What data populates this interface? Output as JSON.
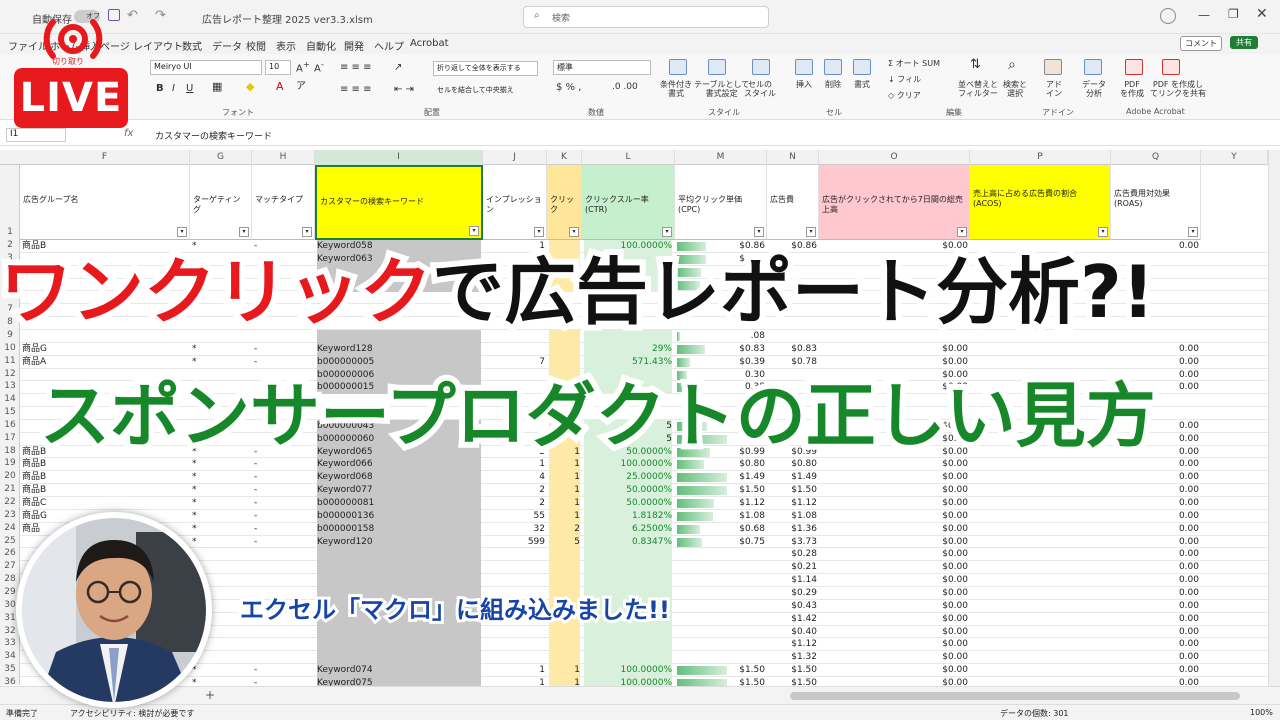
{
  "window": {
    "autosave_label": "自動保存",
    "autosave_state": "オフ",
    "file_title": "広告レポート整理 2025 ver3.3.xlsm",
    "search_placeholder": "検索"
  },
  "menu": {
    "items": [
      "ファイル",
      "ホーム",
      "挿入",
      "ページ レイアウト",
      "数式",
      "データ",
      "校閲",
      "表示",
      "自動化",
      "開発",
      "ヘルプ",
      "Acrobat"
    ],
    "comment_button": "コメント",
    "share_button": "共有"
  },
  "ribbon": {
    "font_name": "Meiryo UI",
    "font_size": "10",
    "wrap_text": "折り返して全体を表示する",
    "merge_center": "セルを結合して中央揃え",
    "number_format": "標準",
    "groups": {
      "font": "フォント",
      "alignment": "配置",
      "number": "数値",
      "styles": "スタイル",
      "cells": "セル",
      "editing": "編集",
      "addins": "アドイン",
      "acrobat": "Adobe Acrobat"
    },
    "buttons": {
      "conditional_format": "条件付き\n書式",
      "format_as_table": "テーブルとして\n書式設定",
      "cell_styles": "セルの\nスタイル",
      "insert": "挿入",
      "delete": "削除",
      "format": "書式",
      "autosum": "オート SUM",
      "fill": "フィル",
      "clear": "クリア",
      "sort_filter": "並べ替えと\nフィルター",
      "find_select": "検索と\n選択",
      "addins": "アド\nイン",
      "data_analysis": "データ\n分析",
      "create_pdf": "PDF\nを作成",
      "create_pdf_share": "PDF を作成し\nてリンクを共有"
    }
  },
  "formula_bar": {
    "name_box": "I1",
    "content": "カスタマーの検索キーワード"
  },
  "columns": [
    "F",
    "G",
    "H",
    "I",
    "J",
    "K",
    "L",
    "M",
    "N",
    "O",
    "P",
    "Q",
    "Y"
  ],
  "headers": [
    "広告グループ名",
    "ターゲティング",
    "マッチタイプ",
    "カスタマーの検索キーワード",
    "インプレッション",
    "クリック",
    "クリックスルー率 (CTR)",
    "平均クリック単価 (CPC)",
    "広告費",
    "広告がクリックされてから7日間の総売上高",
    "売上高に占める広告費の割合 (ACOS)",
    "広告費用対効果 (ROAS)"
  ],
  "rows": [
    {
      "n": "2",
      "F": "商品B",
      "G": "*",
      "H": "-",
      "I": "Keyword058",
      "J": "1",
      "K": "",
      "L": "100.0000%",
      "M": "$0.86",
      "N": "$0.86",
      "O": "$0.00",
      "Q": "0.00"
    },
    {
      "n": "3",
      "F": "",
      "G": "",
      "H": "",
      "I": "Keyword063",
      "J": "",
      "K": "",
      "L": "",
      "M": "$0.86",
      "N": "",
      "O": "",
      "Q": ""
    },
    {
      "n": "4",
      "F": "",
      "G": "",
      "H": "",
      "I": "",
      "J": "",
      "K": "",
      "L": "",
      "M": "$0.72",
      "N": "",
      "O": "",
      "Q": ""
    },
    {
      "n": "5",
      "F": "",
      "G": "",
      "H": "",
      "I": "",
      "J": "",
      "K": "",
      "L": "",
      "M": "$0.7",
      "N": "",
      "O": "",
      "Q": ""
    },
    {
      "n": "9",
      "F": "",
      "G": "",
      "H": "",
      "I": "",
      "J": "",
      "K": "",
      "L": "",
      "M": ".08",
      "N": "",
      "O": "",
      "Q": ""
    },
    {
      "n": "10",
      "F": "商品G",
      "G": "*",
      "H": "-",
      "I": "Keyword128",
      "J": "",
      "K": "",
      "L": "29%",
      "M": "$0.83",
      "N": "$0.83",
      "O": "$0.00",
      "Q": "0.00"
    },
    {
      "n": "11",
      "F": "商品A",
      "G": "*",
      "H": "-",
      "I": "b000000005",
      "J": "7",
      "K": "",
      "L": "571.43%",
      "M": "$0.39",
      "N": "$0.78",
      "O": "$0.00",
      "Q": "0.00"
    },
    {
      "n": "12",
      "F": "",
      "G": "",
      "H": "",
      "I": "b000000006",
      "J": "",
      "K": "",
      "L": "",
      "M": "0.30",
      "N": "",
      "O": "$0.00",
      "Q": "0.00"
    },
    {
      "n": "13",
      "F": "",
      "G": "",
      "H": "",
      "I": "b000000015",
      "J": "",
      "K": "",
      "L": "",
      "M": "0.38",
      "N": "",
      "O": "$0.00",
      "Q": "0.00"
    },
    {
      "n": "16",
      "F": "",
      "G": "",
      "H": "",
      "I": "b000000043",
      "J": "",
      "K": "",
      "L": "5",
      "M": "0.9",
      "N": "",
      "O": "$0.00",
      "Q": "0.00"
    },
    {
      "n": "17",
      "F": "",
      "G": "",
      "H": "",
      "I": "b000000060",
      "J": "",
      "K": "",
      "L": "5",
      "M": "1.50",
      "N": "",
      "O": "$0.00",
      "Q": "0.00"
    },
    {
      "n": "18",
      "F": "商品B",
      "G": "*",
      "H": "-",
      "I": "Keyword065",
      "J": "2",
      "K": "1",
      "L": "50.0000%",
      "M": "$0.99",
      "N": "$0.99",
      "O": "$0.00",
      "Q": "0.00"
    },
    {
      "n": "19",
      "F": "商品B",
      "G": "*",
      "H": "-",
      "I": "Keyword066",
      "J": "1",
      "K": "1",
      "L": "100.0000%",
      "M": "$0.80",
      "N": "$0.80",
      "O": "$0.00",
      "Q": "0.00"
    },
    {
      "n": "20",
      "F": "商品B",
      "G": "*",
      "H": "-",
      "I": "Keyword068",
      "J": "4",
      "K": "1",
      "L": "25.0000%",
      "M": "$1.49",
      "N": "$1.49",
      "O": "$0.00",
      "Q": "0.00"
    },
    {
      "n": "21",
      "F": "商品B",
      "G": "*",
      "H": "-",
      "I": "Keyword077",
      "J": "2",
      "K": "1",
      "L": "50.0000%",
      "M": "$1.50",
      "N": "$1.50",
      "O": "$0.00",
      "Q": "0.00"
    },
    {
      "n": "22",
      "F": "商品C",
      "G": "*",
      "H": "-",
      "I": "b000000081",
      "J": "2",
      "K": "1",
      "L": "50.0000%",
      "M": "$1.12",
      "N": "$1.12",
      "O": "$0.00",
      "Q": "0.00"
    },
    {
      "n": "23",
      "F": "商品G",
      "G": "*",
      "H": "-",
      "I": "b000000136",
      "J": "55",
      "K": "1",
      "L": "1.8182%",
      "M": "$1.08",
      "N": "$1.08",
      "O": "$0.00",
      "Q": "0.00"
    },
    {
      "n": "24",
      "F": "商品",
      "G": "*",
      "H": "-",
      "I": "b000000158",
      "J": "32",
      "K": "2",
      "L": "6.2500%",
      "M": "$0.68",
      "N": "$1.36",
      "O": "$0.00",
      "Q": "0.00"
    },
    {
      "n": "25",
      "F": "",
      "G": "*",
      "H": "-",
      "I": "Keyword120",
      "J": "599",
      "K": "5",
      "L": "0.8347%",
      "M": "$0.75",
      "N": "$3.73",
      "O": "$0.00",
      "Q": "0.00"
    },
    {
      "n": "26",
      "F": "",
      "G": "",
      "H": "",
      "I": "",
      "J": "",
      "K": "",
      "L": "",
      "M": "",
      "N": "$0.28",
      "O": "$0.00",
      "Q": "0.00"
    },
    {
      "n": "27",
      "F": "",
      "G": "",
      "H": "",
      "I": "",
      "J": "",
      "K": "",
      "L": "",
      "M": "",
      "N": "$0.21",
      "O": "$0.00",
      "Q": "0.00"
    },
    {
      "n": "28",
      "F": "",
      "G": "",
      "H": "",
      "I": "",
      "J": "",
      "K": "",
      "L": "",
      "M": "",
      "N": "$1.14",
      "O": "$0.00",
      "Q": "0.00"
    },
    {
      "n": "29",
      "F": "",
      "G": "",
      "H": "",
      "I": "",
      "J": "",
      "K": "",
      "L": "",
      "M": "",
      "N": "$0.29",
      "O": "$0.00",
      "Q": "0.00"
    },
    {
      "n": "30",
      "F": "",
      "G": "",
      "H": "",
      "I": "",
      "J": "",
      "K": "",
      "L": "",
      "M": "",
      "N": "$0.43",
      "O": "$0.00",
      "Q": "0.00"
    },
    {
      "n": "31",
      "F": "",
      "G": "",
      "H": "",
      "I": "",
      "J": "",
      "K": "",
      "L": "",
      "M": "",
      "N": "$1.42",
      "O": "$0.00",
      "Q": "0.00"
    },
    {
      "n": "32",
      "F": "",
      "G": "",
      "H": "",
      "I": "",
      "J": "",
      "K": "",
      "L": "",
      "M": "",
      "N": "$0.40",
      "O": "$0.00",
      "Q": "0.00"
    },
    {
      "n": "33",
      "F": "",
      "G": "",
      "H": "",
      "I": "",
      "J": "",
      "K": "",
      "L": "",
      "M": "",
      "N": "$1.12",
      "O": "$0.00",
      "Q": "0.00"
    },
    {
      "n": "34",
      "F": "",
      "G": "",
      "H": "",
      "I": "",
      "J": "",
      "K": "",
      "L": "",
      "M": "",
      "N": "$1.32",
      "O": "$0.00",
      "Q": "0.00"
    },
    {
      "n": "35",
      "F": "",
      "G": "*",
      "H": "-",
      "I": "Keyword074",
      "J": "1",
      "K": "1",
      "L": "100.0000%",
      "M": "$1.50",
      "N": "$1.50",
      "O": "$0.00",
      "Q": "0.00"
    },
    {
      "n": "36",
      "F": "",
      "G": "*",
      "H": "-",
      "I": "Keyword075",
      "J": "1",
      "K": "1",
      "L": "100.0000%",
      "M": "$1.50",
      "N": "$1.50",
      "O": "$0.00",
      "Q": "0.00"
    }
  ],
  "overlay": {
    "live_small": "切り取り",
    "live": "LIVE",
    "title_red": "ワンクリック",
    "title_black": "で広告レポート分析?!",
    "subtitle": "スポンサープロダクトの正しい見方",
    "macro_text": "エクセル「マクロ」に組み込みました!!"
  },
  "status_bar": {
    "ready": "準備完了",
    "accessibility": "アクセシビリティ: 検討が必要です",
    "count": "データの個数: 301",
    "zoom": "100%"
  },
  "colors": {
    "live_red": "#e8191d",
    "title_red": "#e8191d",
    "subtitle_green": "#17882a",
    "macro_blue": "#1745a6",
    "header_yellow": "#ffff00",
    "header_pink": "#ffc7ce",
    "header_green": "#c6efce",
    "header_orange": "#ffe699"
  }
}
